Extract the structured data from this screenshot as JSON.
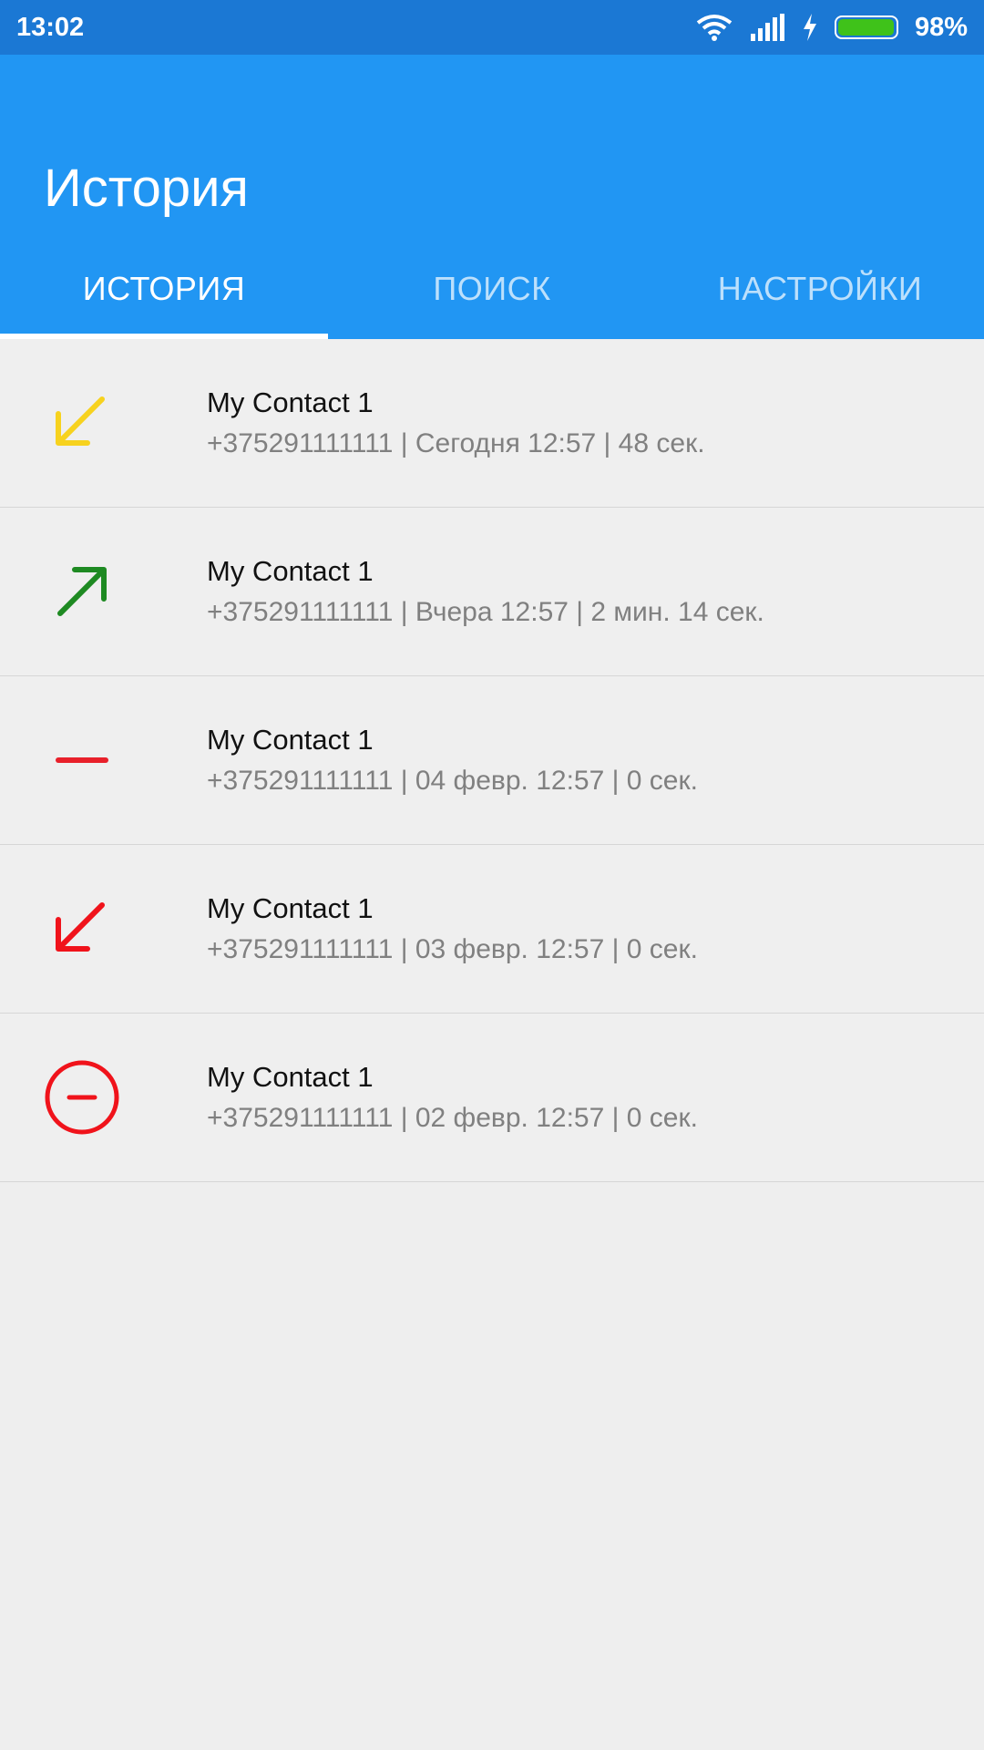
{
  "status_bar": {
    "time": "13:02",
    "battery_percent": "98%",
    "battery_level": 0.98,
    "icons": [
      "wifi-icon",
      "signal-icon",
      "charging-icon",
      "battery-icon"
    ]
  },
  "app_bar": {
    "title": "История",
    "color": "#2196f3"
  },
  "tabs": [
    {
      "label": "ИСТОРИЯ",
      "active": true
    },
    {
      "label": "ПОИСК",
      "active": false
    },
    {
      "label": "НАСТРОЙКИ",
      "active": false
    }
  ],
  "history": [
    {
      "type": "incoming",
      "icon": "incoming-call-arrow-icon",
      "color": "#f7d21e",
      "name": "My Contact 1",
      "details": "+375291111111 | Сегодня 12:57 | 48 сек."
    },
    {
      "type": "outgoing",
      "icon": "outgoing-call-arrow-icon",
      "color": "#1e8a22",
      "name": "My Contact 1",
      "details": "+375291111111 | Вчера 12:57 | 2 мин. 14 сек."
    },
    {
      "type": "dash",
      "icon": "dash-icon",
      "color": "#e8202a",
      "name": "My Contact 1",
      "details": "+375291111111 | 04 февр. 12:57 | 0 сек."
    },
    {
      "type": "missed",
      "icon": "missed-call-arrow-icon",
      "color": "#f0131b",
      "name": "My Contact 1",
      "details": "+375291111111 | 03 февр. 12:57 | 0 сек."
    },
    {
      "type": "rejected",
      "icon": "rejected-call-icon",
      "color": "#f0131b",
      "name": "My Contact 1",
      "details": "+375291111111 | 02 февр. 12:57 | 0 сек."
    }
  ]
}
